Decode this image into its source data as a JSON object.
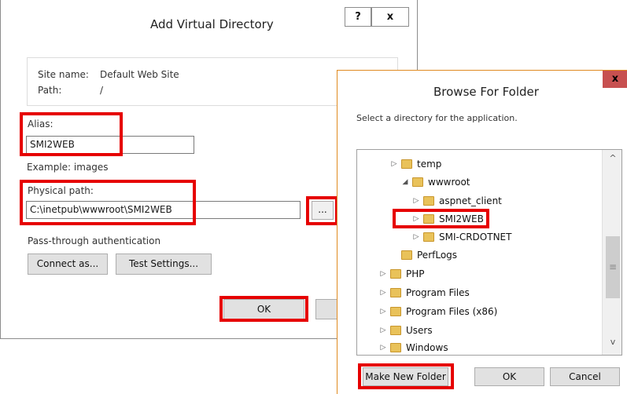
{
  "add_dialog": {
    "title": "Add Virtual Directory",
    "help_btn": "?",
    "close_btn": "x",
    "site_name_label": "Site name:",
    "site_name_value": "Default Web Site",
    "path_label": "Path:",
    "path_value": "/",
    "alias_label": "Alias:",
    "alias_value": "SMI2WEB",
    "example_text": "Example: images",
    "physical_path_label": "Physical path:",
    "physical_path_value": "C:\\inetpub\\wwwroot\\SMI2WEB",
    "browse_btn": "...",
    "passthrough_label": "Pass-through authentication",
    "connect_as_btn": "Connect as...",
    "test_settings_btn": "Test Settings...",
    "ok_btn": "OK"
  },
  "browse_dialog": {
    "title": "Browse For Folder",
    "close_btn": "x",
    "instruction": "Select a directory for the application.",
    "tree": [
      {
        "label": "temp",
        "arrow": "▷"
      },
      {
        "label": "wwwroot",
        "arrow": "◢"
      },
      {
        "label": "aspnet_client",
        "arrow": "▷"
      },
      {
        "label": "SMI2WEB",
        "arrow": "▷"
      },
      {
        "label": "SMI-CRDOTNET",
        "arrow": "▷"
      },
      {
        "label": "PerfLogs",
        "arrow": ""
      },
      {
        "label": "PHP",
        "arrow": "▷"
      },
      {
        "label": "Program Files",
        "arrow": "▷"
      },
      {
        "label": "Program Files (x86)",
        "arrow": "▷"
      },
      {
        "label": "Users",
        "arrow": "▷"
      },
      {
        "label": "Windows",
        "arrow": "▷"
      }
    ],
    "scroll_up": "^",
    "scroll_down": "v",
    "scroll_grip": "≡",
    "make_new_folder_btn": "Make New Folder",
    "ok_btn": "OK",
    "cancel_btn": "Cancel"
  },
  "colors": {
    "highlight": "#e60000",
    "folder": "#e9c25a"
  }
}
